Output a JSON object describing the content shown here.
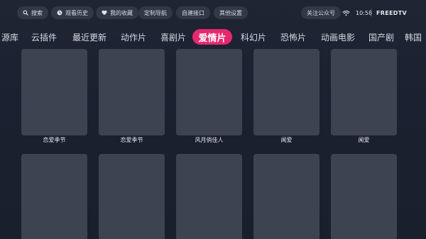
{
  "toolbar": {
    "search": "搜索",
    "history": "观看历史",
    "favorites": "我的收藏",
    "custom_nav": "定制导航",
    "custom_api": "自建接口",
    "settings": "其他设置"
  },
  "status": {
    "follow": "关注公众号",
    "time": "10:58",
    "brand": "FREEDTV"
  },
  "categories": {
    "c0": "源库",
    "c1": "云插件",
    "c2": "最近更新",
    "c3": "动作片",
    "c4": "喜剧片",
    "c5": "爱情片",
    "c6": "科幻片",
    "c7": "恐怖片",
    "c8": "动画电影",
    "c9": "国产剧",
    "c10": "韩国"
  },
  "items": {
    "i0": "恋爱季节",
    "i1": "恋爱季节",
    "i2": "风月俏佳人",
    "i3": "闻爱",
    "i4": "闻爱"
  },
  "selected_category": "爱情片",
  "colors": {
    "accent": "#e6286f",
    "background": "#1d2230",
    "poster_placeholder": "#3d4350"
  }
}
